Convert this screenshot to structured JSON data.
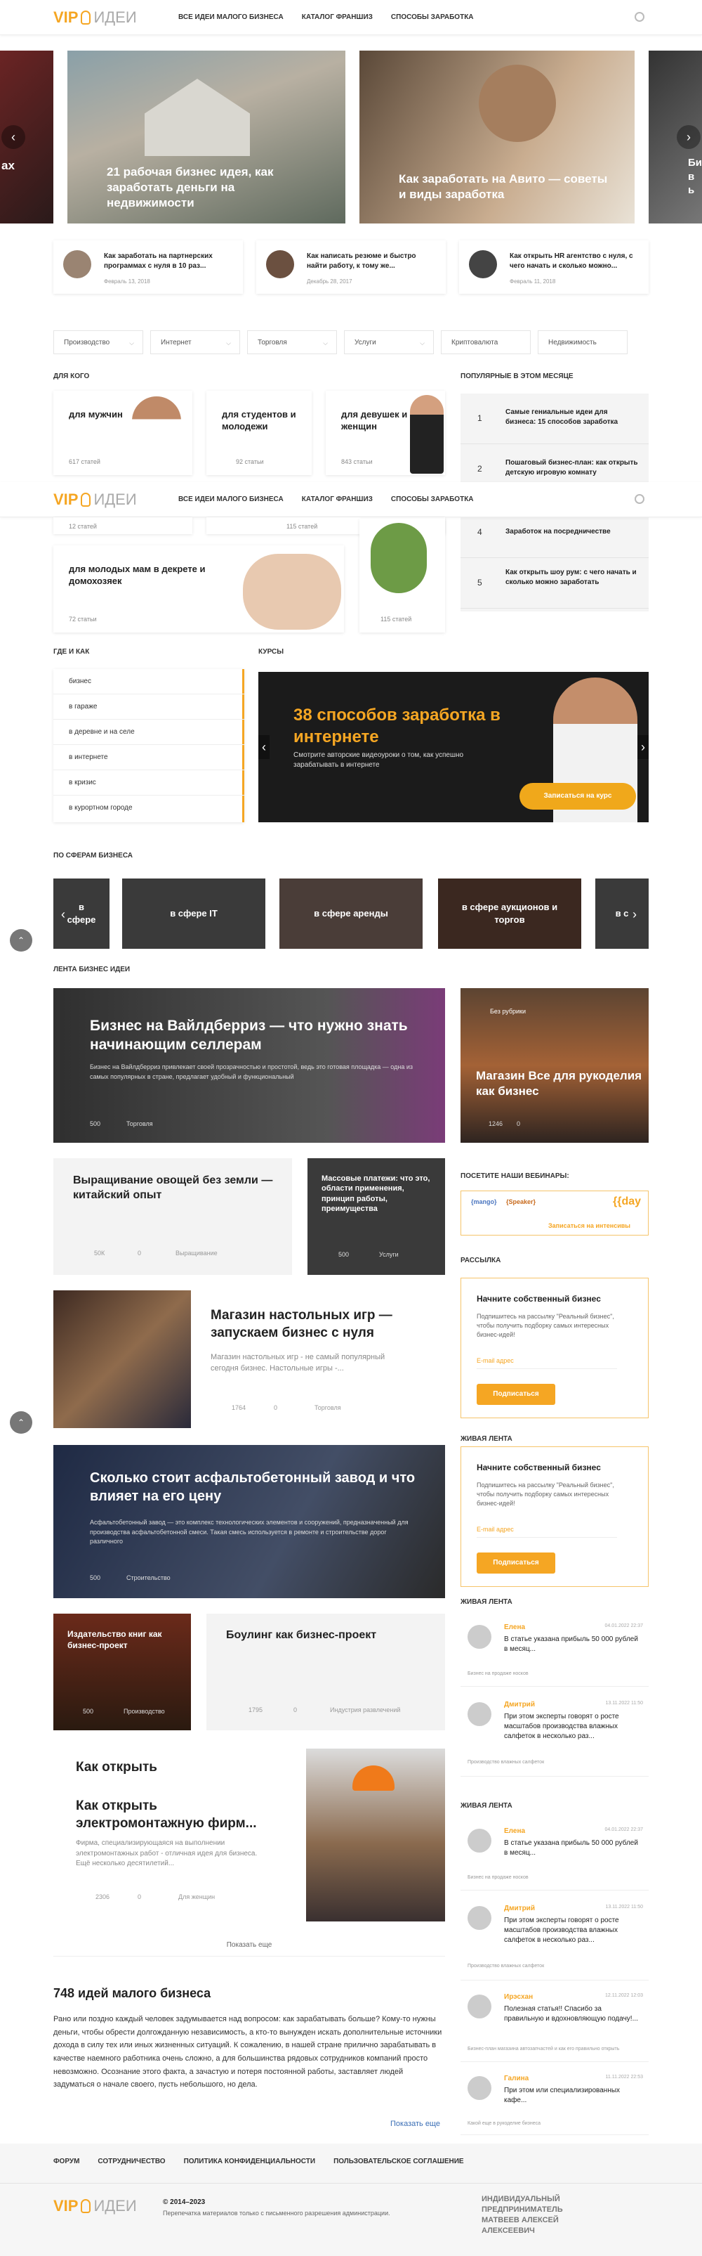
{
  "header": {
    "logo_vip": "VIP",
    "logo_ideas": "ИДЕИ",
    "nav": [
      "Все идеи малого бизнеса",
      "Каталог франшиз",
      "Способы заработка"
    ]
  },
  "slider": {
    "left_cut": "ах",
    "slides": [
      "21 рабочая бизнес идея, как заработать деньги на недвижимости",
      "Как заработать на Авито — советы и виды заработка"
    ],
    "right_cut": "Би в ь"
  },
  "minis": [
    {
      "title": "Как заработать на партнерских программах с нуля в 10 раз...",
      "date": "Февраль 13, 2018"
    },
    {
      "title": "Как написать резюме и быстро найти работу, к тому же...",
      "date": "Декабрь 28, 2017"
    },
    {
      "title": "Как открыть HR агентство с нуля, с чего начать и сколько можно...",
      "date": "Февраль 11, 2018"
    }
  ],
  "filters": [
    "Производство",
    "Интернет",
    "Торговля",
    "Услуги",
    "Криптовалюта",
    "Недвижимость"
  ],
  "for_whom": {
    "title": "Для кого",
    "cards": [
      {
        "title": "для мужчин",
        "count": "617 статей"
      },
      {
        "title": "для студентов и молодежи",
        "count": "92 статьи"
      },
      {
        "title": "для девушек и женщин",
        "count": "843 статьи"
      },
      {
        "title": "",
        "count": "12 статей"
      },
      {
        "title": "",
        "count": "115 статей"
      },
      {
        "title": "для молодых мам в декрете и домохозяек",
        "count": "72 статьи"
      },
      {
        "title": "",
        "count": "115 статей"
      }
    ]
  },
  "popular": {
    "title": "Популярные в этом месяце",
    "items": [
      {
        "n": "1",
        "t": "Самые гениальные идеи для бизнеса: 15 способов заработка"
      },
      {
        "n": "2",
        "t": "Пошаговый бизнес-план: как открыть детскую игровую комнату"
      },
      {
        "n": "4",
        "t": "Заработок на посредничестве"
      },
      {
        "n": "5",
        "t": "Как открыть шоу рум: с чего начать и сколько можно заработать"
      }
    ]
  },
  "where": {
    "title": "Где и как",
    "items": [
      "бизнес",
      "в гараже",
      "в деревне и на селе",
      "в интернете",
      "в кризис",
      "в курортном городе"
    ]
  },
  "courses": {
    "title": "Курсы",
    "headline": "38 способов заработка в интернете",
    "sub": "Смотрите авторские видеоуроки о том, как успешно зарабатывать в интернете",
    "btn": "Записаться на курс"
  },
  "spheres": {
    "title": "По сферам бизнеса",
    "items": [
      "в сфере",
      "в сфере IT",
      "в сфере аренды",
      "в сфере аукционов и торгов",
      "в с"
    ]
  },
  "feed": {
    "title": "Лента бизнес идеи",
    "big1": {
      "title": "Бизнес на Вайлдберриз — что нужно знать начинающим селлерам",
      "text": "Бизнес на Вайлдберриз привлекает своей прозрачностью и простотой, ведь это готовая площадка — одна из самых популярных в стране, предлагает удобный и функциональный",
      "views": "500",
      "tag": "Торговля"
    },
    "side1": {
      "badge": "Без рубрики",
      "title": "Магазин Все для рукоделия как бизнес",
      "views": "1246",
      "c": "0"
    },
    "veg": {
      "title": "Выращивание овощей без земли — китайский опыт",
      "views": "50К",
      "c": "0",
      "tag": "Выращивание"
    },
    "pay": {
      "title": "Массовые платежи: что это, области применения, принцип работы, преимущества",
      "views": "500",
      "tag": "Услуги"
    },
    "games": {
      "title": "Магазин настольных игр — запускаем бизнес с нуля",
      "text": "Магазин настольных игр - не самый популярный сегодня бизнес. Настольные игры -...",
      "views": "1764",
      "c": "0",
      "tag": "Торговля"
    },
    "asphalt": {
      "title": "Сколько стоит асфальтобетонный завод и что влияет на его цену",
      "text": "Асфальтобетонный завод — это комплекс технологических элементов и сооружений, предназначенный для производства асфальтобетонной смеси. Такая смесь используется в ремонте и строительстве дорог различного",
      "views": "500",
      "tag": "Строительство"
    },
    "books": {
      "title": "Издательство книг как бизнес-проект",
      "views": "500",
      "tag": "Производство"
    },
    "bowling": {
      "title": "Боулинг как бизнес-проект",
      "views": "1795",
      "c": "0",
      "tag": "Индустрия развлечений"
    },
    "electro": {
      "t1": "Как открыть",
      "t2": "Как открыть электромонтажную фирм...",
      "text": "Фирма, специализирующаяся на выполнении электромонтажных работ - отличная идея для бизнеса. Ещё несколько десятилетий...",
      "views": "2306",
      "c": "0",
      "tag": "Для женщин"
    },
    "more": "Показать еще"
  },
  "webinars": {
    "title": "Посетите наши вебинары:",
    "logos": [
      "{mango}",
      "{Speaker}",
      "{{day"
    ],
    "btn": "Записаться на интенсивы"
  },
  "newsletter": {
    "title": "Рассылка",
    "h": "Начните собственный бизнес",
    "p": "Подпишитесь на рассылку \"Реальный бизнес\", чтобы получить подборку самых интересных бизнес-идей!",
    "email": "E-mail адрес",
    "btn": "Подписаться"
  },
  "live1": {
    "title": "Живая лента"
  },
  "live2": {
    "title": "Живая лента",
    "items": [
      {
        "name": "Елена",
        "date": "04.01.2022 22:37",
        "text": "В статье указана прибыль 50 000 рублей в месяц...",
        "link": "Бизнес на продаже носков"
      },
      {
        "name": "Дмитрий",
        "date": "13.11.2022 11:50",
        "text": "При этом эксперты говорят о росте масштабов производства влажных салфеток в несколько раз...",
        "link": "Производство влажных салфеток"
      }
    ]
  },
  "live3": {
    "title": "Живая лента",
    "items": [
      {
        "name": "Елена",
        "date": "04.01.2022 22:37",
        "text": "В статье указана прибыль 50 000 рублей в месяц...",
        "link": "Бизнес на продаже носков"
      },
      {
        "name": "Дмитрий",
        "date": "13.11.2022 11:50",
        "text": "При этом эксперты говорят о росте масштабов производства влажных салфеток в несколько раз...",
        "link": "Производство влажных салфеток"
      },
      {
        "name": "Ирэсхан",
        "date": "12.11.2022 12:03",
        "text": "Полезная статья!! Спасибо за правильную и вдохновляющую подачу!...",
        "link": "Бизнес-план магазина автозапчастей и как его правильно открыть"
      },
      {
        "name": "Галина",
        "date": "11.11.2022 22:53",
        "text": "При этом или специализированных кафе...",
        "link": "Какой еще в рукоделие бизнеса"
      }
    ]
  },
  "seo": {
    "title": "748 идей малого бизнеса",
    "text": "Рано или поздно каждый человек задумывается над вопросом: как зарабатывать больше? Кому-то нужны деньги, чтобы обрести долгожданную независимость, а кто-то вынужден искать дополнительные источники дохода в силу тех или иных жизненных ситуаций. К сожалению, в нашей стране прилично зарабатывать в качестве наемного работника очень сложно, а для большинства рядовых сотрудников компаний просто невозможно. Осознание этого факта, а зачастую и потеря постоянной работы, заставляет людей задуматься о начале своего, пусть небольшого, но дела.",
    "more": "Показать еще"
  },
  "footer": {
    "links": [
      "Форум",
      "Сотрудничество",
      "Политика конфиденциальности",
      "Пользовательское соглашение"
    ],
    "copy": "© 2014–2023",
    "note": "Перепечатка материалов только с письменного разрешения администрации.",
    "owner": "ИНДИВИДУАЛЬНЫЙ ПРЕДПРИНИМАТЕЛЬ МАТВЕЕВ АЛЕКСЕЙ АЛЕКСЕЕВИЧ"
  }
}
